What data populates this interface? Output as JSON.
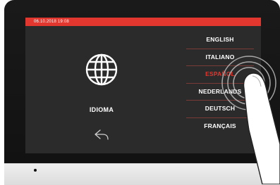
{
  "statusbar": {
    "datetime": "06.10.2018  19:08"
  },
  "language_panel": {
    "title": "IDIOMA",
    "icon": "globe-icon",
    "back_icon": "back-arrow-icon"
  },
  "languages": [
    {
      "label": "ENGLISH",
      "selected": false
    },
    {
      "label": "ITALIANO",
      "selected": false
    },
    {
      "label": "ESPAÑOL",
      "selected": true
    },
    {
      "label": "NEDERLANDS",
      "selected": false
    },
    {
      "label": "DEUTSCH",
      "selected": false
    },
    {
      "label": "FRANÇAIS",
      "selected": false
    }
  ],
  "colors": {
    "accent": "#e2372f",
    "screen_bg": "#2b2b2b",
    "bezel": "#141414"
  }
}
